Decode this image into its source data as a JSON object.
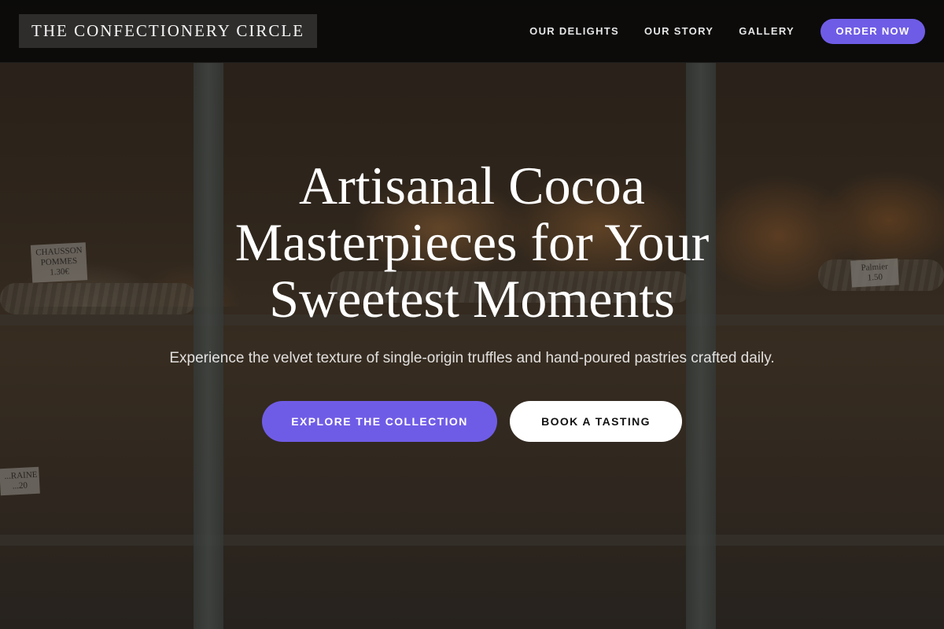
{
  "header": {
    "logo": "THE CONFECTIONERY CIRCLE",
    "nav": [
      {
        "label": "OUR DELIGHTS"
      },
      {
        "label": "OUR STORY"
      },
      {
        "label": "GALLERY"
      }
    ],
    "order_button": "ORDER NOW"
  },
  "hero": {
    "title_lines": [
      "Artisanal Cocoa",
      "Masterpieces for Your",
      "Sweetest Moments"
    ],
    "subtitle": "Experience the velvet texture of single-origin truffles and hand-poured pastries crafted daily.",
    "primary_cta": "EXPLORE THE COLLECTION",
    "secondary_cta": "BOOK A TASTING"
  },
  "background": {
    "price_tags": [
      {
        "text": "CHAUSSON POMMES 1.30€"
      },
      {
        "text": "Palmier 1.50"
      },
      {
        "text": "...RAINE ...20"
      }
    ]
  },
  "colors": {
    "accent": "#6f5ce6",
    "header_bg": "#080808",
    "text_light": "#ffffff"
  }
}
